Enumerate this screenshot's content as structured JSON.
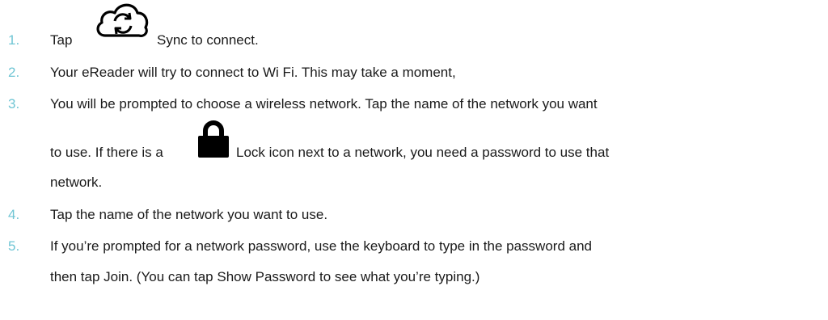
{
  "steps": [
    {
      "number": "1.",
      "parts": {
        "before_icon": "Tap",
        "icon": "sync-cloud-icon",
        "after_icon": "Sync to connect."
      }
    },
    {
      "number": "2.",
      "text": "Your eReader will try to connect to Wi Fi. This may take a moment,"
    },
    {
      "number": "3.",
      "line1": "You will be prompted to choose a wireless network. Tap the name of the network you want",
      "line2_before_icon": "to use. If there is a",
      "icon": "lock-icon",
      "line2_after_icon": "Lock icon next to a network, you need a password to use that",
      "line3": "network."
    },
    {
      "number": "4.",
      "text": "Tap the name of the network you want to use."
    },
    {
      "number": "5.",
      "line1": "If you’re prompted for a network password, use the keyboard to type in the password and",
      "line2": "then tap Join. (You can tap Show Password to see what you’re typing.)"
    }
  ],
  "colors": {
    "number": "#6fc5d4",
    "text": "#1a1a1a",
    "icon": "#000000"
  }
}
